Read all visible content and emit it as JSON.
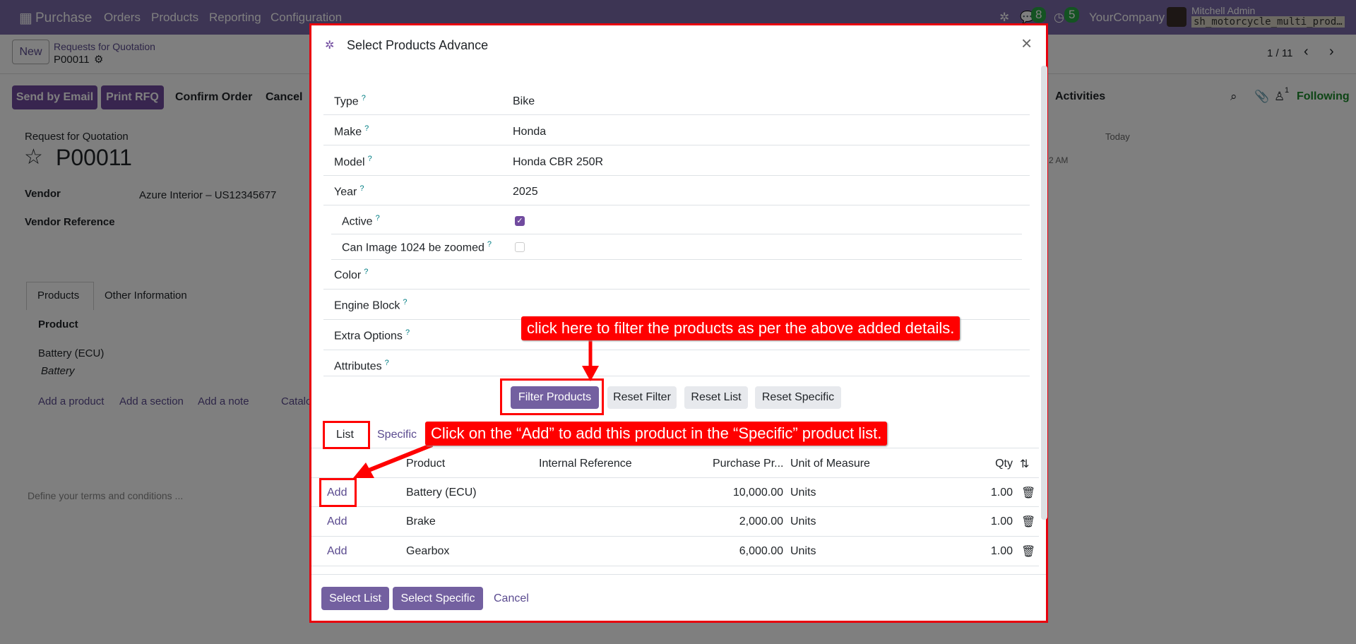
{
  "navbar": {
    "app": "Purchase",
    "menu": [
      "Orders",
      "Products",
      "Reporting",
      "Configuration"
    ],
    "messages_count": "8",
    "activities_count": "5",
    "company": "YourCompany",
    "user": "Mitchell Admin",
    "database": "sh_motorcycle_multi_prod…"
  },
  "page": {
    "new_label": "New",
    "breadcrumb": "Requests for Quotation",
    "record": "P00011",
    "pager": "1 / 11",
    "actions": [
      "Send by Email",
      "Print RFQ",
      "Confirm Order",
      "Cancel"
    ],
    "form_subtitle": "Request for Quotation",
    "form_title": "P00011",
    "vendor_label": "Vendor",
    "vendor_value": "Azure Interior – US12345677",
    "vendor_ref_label": "Vendor Reference",
    "tabs": [
      "Products",
      "Other Information"
    ],
    "product_col": "Product",
    "line_product": "Battery (ECU)",
    "line_desc": "Battery",
    "line_actions": [
      "Add a product",
      "Add a section",
      "Add a note",
      "Catalo"
    ],
    "terms_placeholder": "Define your terms and conditions ...",
    "chatter": {
      "activities": "Activities",
      "followers": "1",
      "following": "Following",
      "today": "Today",
      "time": "2 AM"
    }
  },
  "dialog": {
    "title": "Select Products Advance",
    "fields": [
      {
        "label": "Type",
        "value": "Bike"
      },
      {
        "label": "Make",
        "value": "Honda"
      },
      {
        "label": "Model",
        "value": "Honda CBR 250R"
      },
      {
        "label": "Year",
        "value": "2025"
      },
      {
        "label": "Active",
        "value": ""
      },
      {
        "label": "Can Image 1024 be zoomed",
        "value": ""
      },
      {
        "label": "Color",
        "value": ""
      },
      {
        "label": "Engine Block",
        "value": ""
      },
      {
        "label": "Extra Options",
        "value": ""
      },
      {
        "label": "Attributes",
        "value": ""
      }
    ],
    "active_checked": true,
    "zoom_checked": false,
    "buttons": [
      "Filter Products",
      "Reset Filter",
      "Reset List",
      "Reset Specific"
    ],
    "tabs": [
      "List",
      "Specific"
    ],
    "columns": [
      "Product",
      "Internal Reference",
      "Purchase Pr...",
      "Unit of Measure",
      "Qty"
    ],
    "rows": [
      {
        "action": "Add",
        "product": "Battery (ECU)",
        "ref": "",
        "price": "10,000.00",
        "uom": "Units",
        "qty": "1.00"
      },
      {
        "action": "Add",
        "product": "Brake",
        "ref": "",
        "price": "2,000.00",
        "uom": "Units",
        "qty": "1.00"
      },
      {
        "action": "Add",
        "product": "Gearbox",
        "ref": "",
        "price": "6,000.00",
        "uom": "Units",
        "qty": "1.00"
      }
    ],
    "footer": [
      "Select List",
      "Select Specific",
      "Cancel"
    ]
  },
  "annotations": {
    "filter_hint": "click here to filter the products as per the above added details.",
    "add_hint": "Click on the “Add” to add this product in the “Specific” product list."
  },
  "colors": {
    "primary": "#714b9f",
    "annotation": "#ff0000"
  }
}
